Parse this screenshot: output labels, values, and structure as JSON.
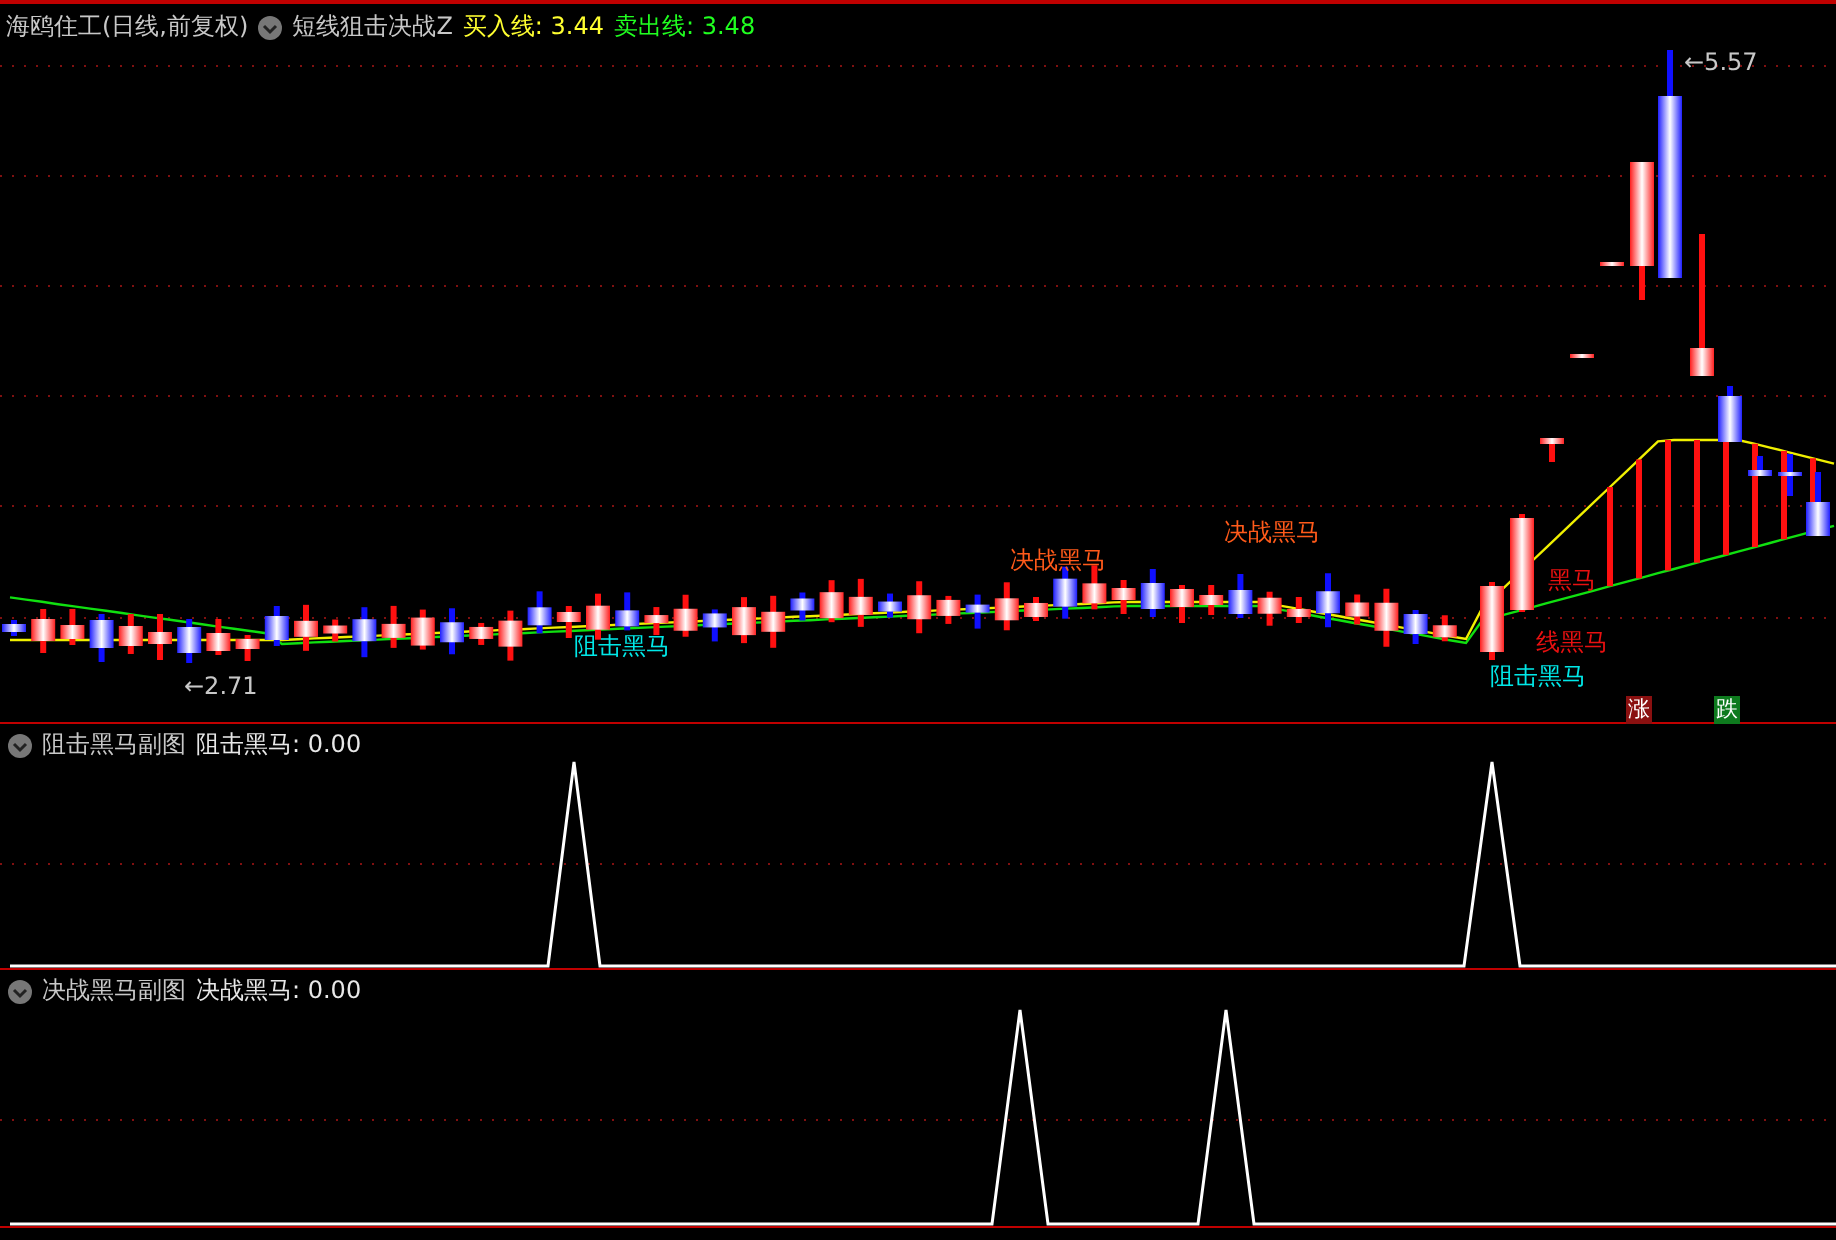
{
  "header": {
    "stock": "海鸥住工(日线,前复权)",
    "indicator": "短线狙击决战Z",
    "buy_label": "买入线: 3.44",
    "sell_label": "卖出线: 3.48"
  },
  "main_chart": {
    "labels": [
      {
        "text": "决战黑马",
        "kind": "decisive"
      },
      {
        "text": "决战黑马",
        "kind": "decisive"
      },
      {
        "text": "阻击黑马",
        "kind": "block"
      },
      {
        "text": "阻击黑马",
        "kind": "block"
      },
      {
        "text": "黑马",
        "kind": "short"
      },
      {
        "text": "线黑马",
        "kind": "short"
      }
    ],
    "price_marks": [
      {
        "text": "←5.57"
      },
      {
        "text": "←2.71"
      }
    ],
    "badges": [
      {
        "text": "涨",
        "kind": "rise"
      },
      {
        "text": "跌",
        "kind": "fall"
      }
    ]
  },
  "panels": [
    {
      "title": "阻击黑马副图",
      "reading": "阻击黑马: 0.00"
    },
    {
      "title": "决战黑马副图",
      "reading": "决战黑马: 0.00"
    }
  ]
}
